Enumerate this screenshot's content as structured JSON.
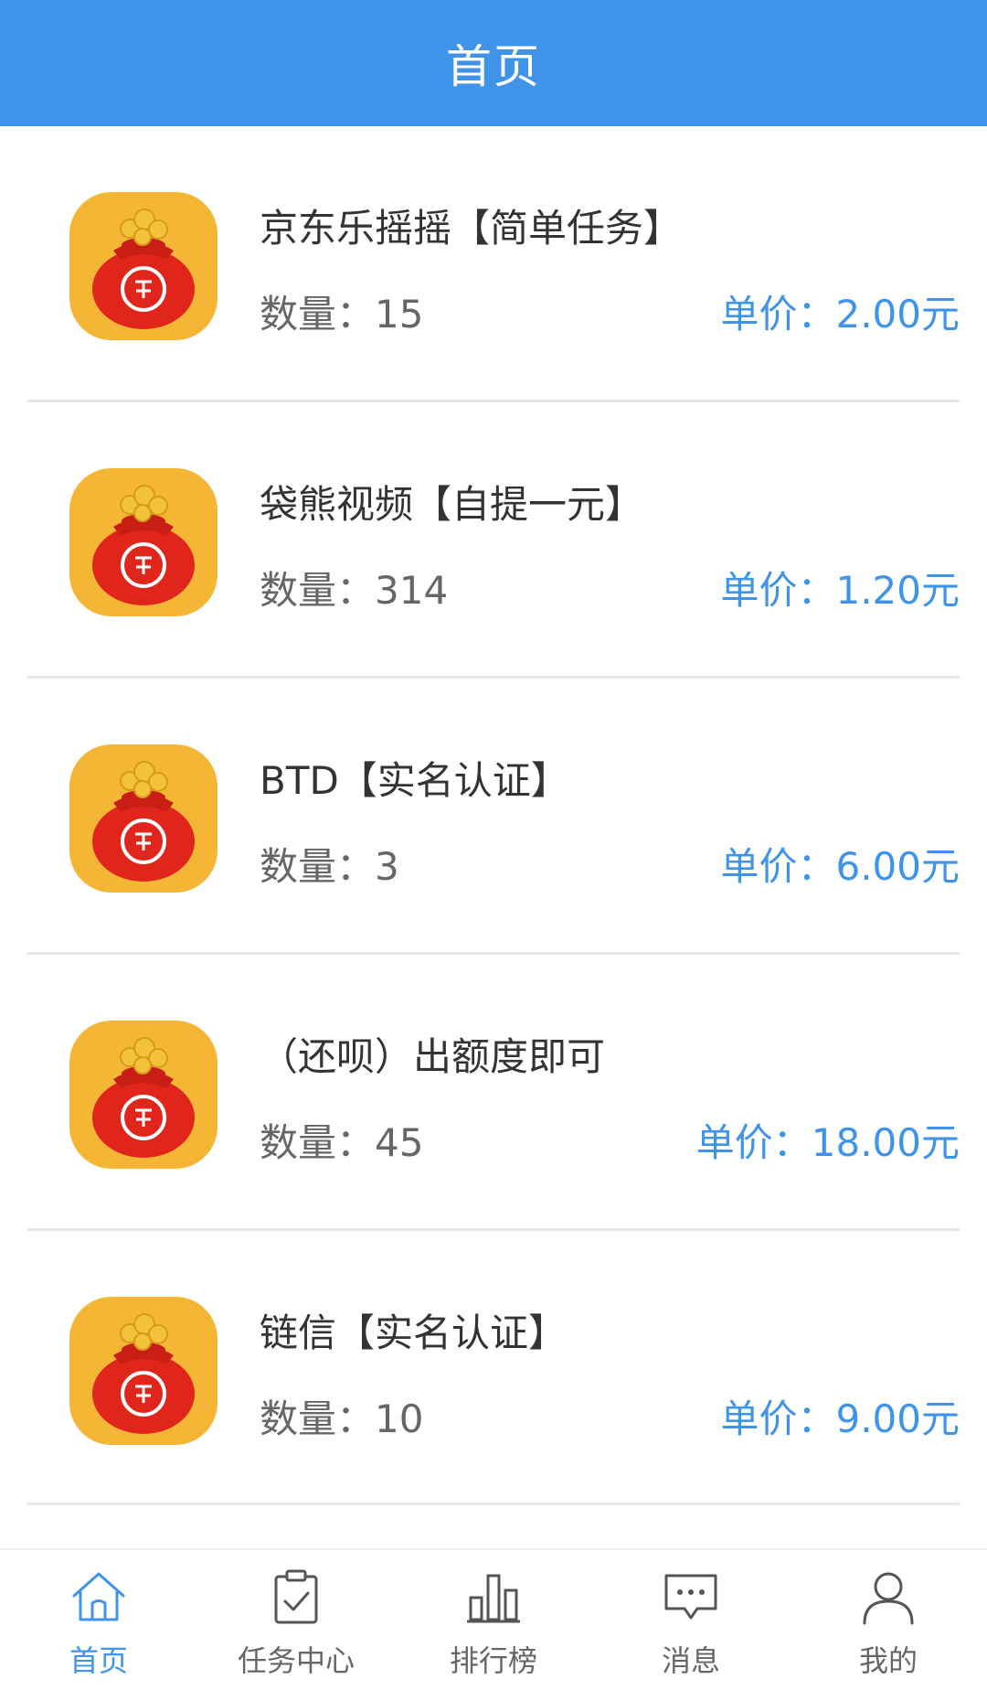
{
  "header": {
    "title": "首页"
  },
  "tasks": [
    {
      "title": "京东乐摇摇【简单任务】",
      "quantity": "数量：15",
      "price": "单价：2.00元",
      "icon": "reward-bag-icon"
    },
    {
      "title": "袋熊视频【自提一元】",
      "quantity": "数量：314",
      "price": "单价：1.20元",
      "icon": "reward-bag-icon"
    },
    {
      "title": "BTD【实名认证】",
      "quantity": "数量：3",
      "price": "单价：6.00元",
      "icon": "reward-bag-icon"
    },
    {
      "title": "（还呗）出额度即可",
      "quantity": "数量：45",
      "price": "单价：18.00元",
      "icon": "reward-bag-icon"
    },
    {
      "title": "链信【实名认证】",
      "quantity": "数量：10",
      "price": "单价：9.00元",
      "icon": "reward-bag-icon"
    }
  ],
  "tabbar": {
    "tabs": [
      {
        "label": "首页",
        "icon": "home-icon",
        "active": true
      },
      {
        "label": "任务中心",
        "icon": "clipboard-check-icon",
        "active": false
      },
      {
        "label": "排行榜",
        "icon": "bar-chart-icon",
        "active": false
      },
      {
        "label": "消息",
        "icon": "message-icon",
        "active": false
      },
      {
        "label": "我的",
        "icon": "user-icon",
        "active": false
      }
    ]
  },
  "colors": {
    "primary": "#3f94ea",
    "icon_background": "#f6b635",
    "bag_red": "#e0261c",
    "text_dark": "#333333",
    "text_gray": "#666666",
    "divider": "#e6e6e6"
  }
}
